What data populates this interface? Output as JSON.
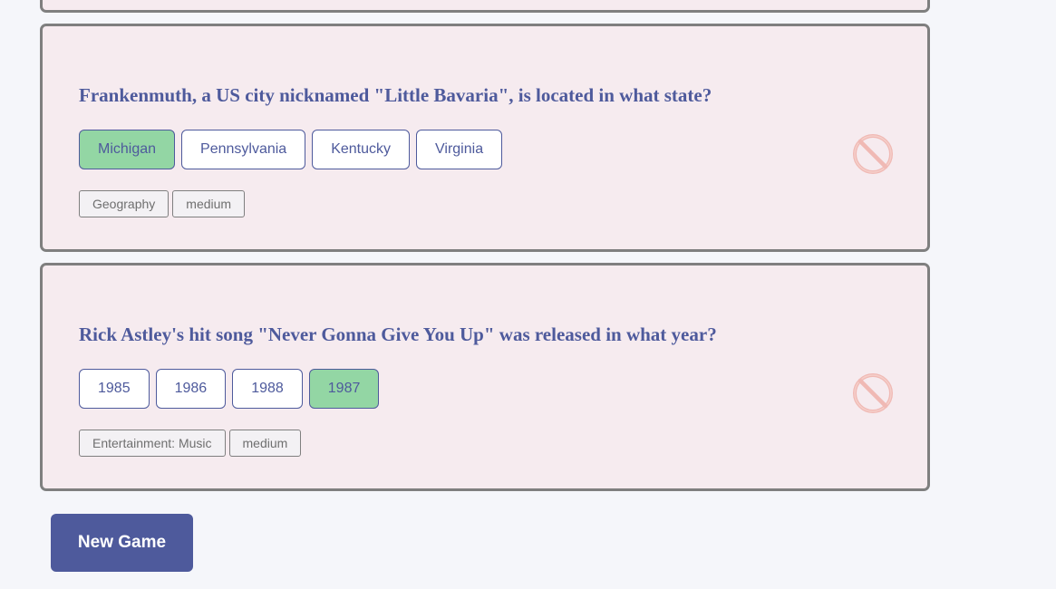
{
  "questions": [
    {
      "text": "Frankenmuth, a US city nicknamed \"Little Bavaria\", is located in what state?",
      "answers": [
        {
          "label": "Michigan",
          "state": "correct"
        },
        {
          "label": "Pennsylvania",
          "state": "default"
        },
        {
          "label": "Kentucky",
          "state": "default"
        },
        {
          "label": "Virginia",
          "state": "default"
        }
      ],
      "category": "Geography",
      "difficulty": "medium",
      "status_icon": "no-entry-icon"
    },
    {
      "text": "Rick Astley's hit song \"Never Gonna Give You Up\" was released in what year?",
      "answers": [
        {
          "label": "1985",
          "state": "default"
        },
        {
          "label": "1986",
          "state": "default"
        },
        {
          "label": "1988",
          "state": "default"
        },
        {
          "label": "1987",
          "state": "correct"
        }
      ],
      "category": "Entertainment: Music",
      "difficulty": "medium",
      "status_icon": "no-entry-icon"
    }
  ],
  "new_game_label": "New Game",
  "colors": {
    "page_background": "#f5f6fa",
    "card_background": "#f6ebef",
    "card_border": "#7f7f7f",
    "primary": "#4e5a9c",
    "correct_answer": "#93d6a4",
    "status_icon": "#f0b9b4"
  }
}
